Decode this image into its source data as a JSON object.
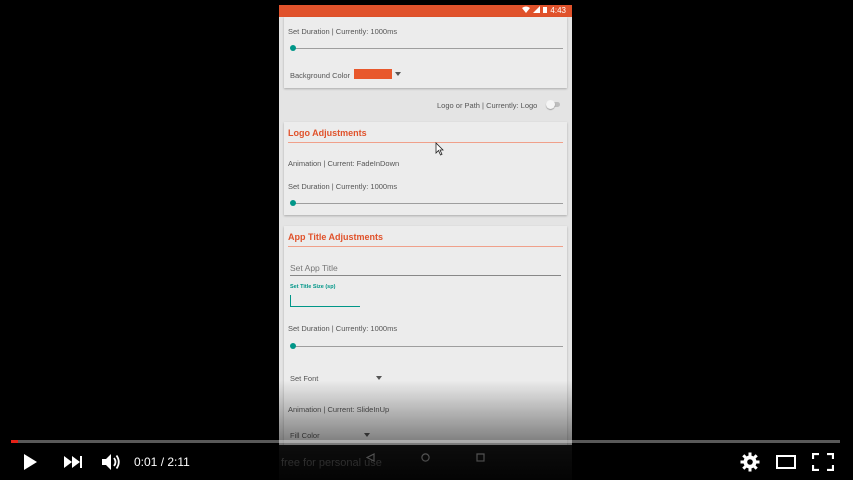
{
  "status_bar": {
    "time": "4:43"
  },
  "top_section": {
    "duration_label": "Set Duration | Currently: 1000ms",
    "bg_color_label": "Background Color",
    "bg_color": "#e8582c",
    "logo_or_path_label": "Logo or Path | Currently: Logo"
  },
  "logo_section": {
    "title": "Logo Adjustments",
    "animation_label": "Animation | Current:  FadeInDown",
    "duration_label": "Set Duration | Currently: 1000ms"
  },
  "app_title_section": {
    "title": "App Title Adjustments",
    "title_input_placeholder": "Set App Title",
    "size_input_label": "Set Title Size (sp)",
    "duration_label": "Set Duration | Currently: 1000ms",
    "font_label": "Set Font",
    "animation_label": "Animation | Current:  SlideInUp",
    "fill_color_label": "Fill Color"
  },
  "watermark": "free for personal use",
  "player": {
    "time_display": "0:01 / 2:11",
    "progress_fraction": 0.008
  },
  "colors": {
    "accent": "#e0522b",
    "teal": "#009688",
    "progress": "#e52117"
  }
}
